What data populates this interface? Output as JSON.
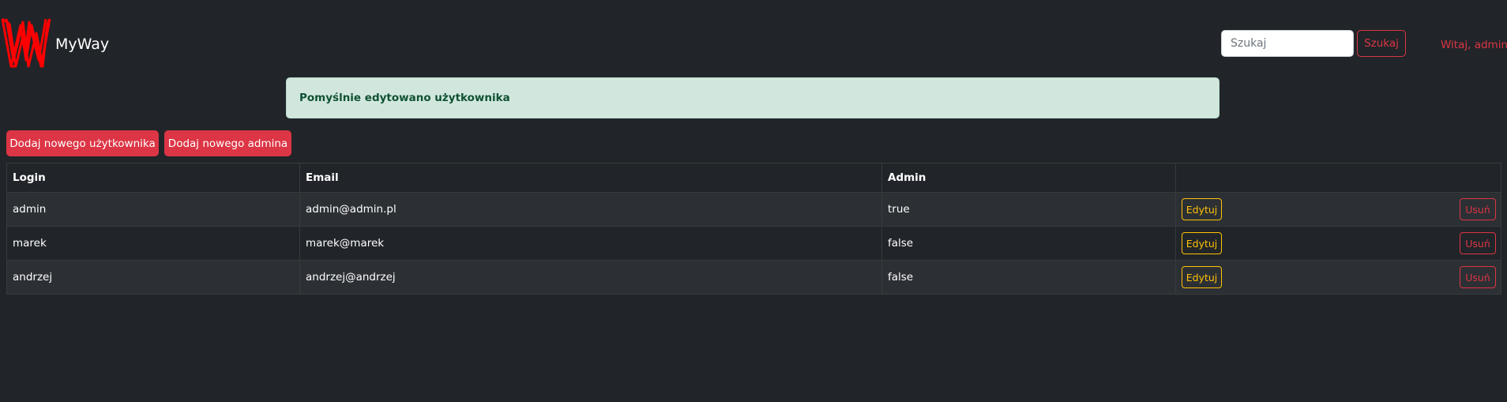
{
  "navbar": {
    "brand": "MyWay",
    "search_placeholder": "Szukaj",
    "search_button": "Szukaj",
    "user_menu": "Witaj, admin",
    "accent_color": "#dc3545"
  },
  "alert": {
    "message": "Pomyślnie edytowano użytkownika",
    "type": "success"
  },
  "actions": {
    "add_user": "Dodaj nowego użytkownika",
    "add_admin": "Dodaj nowego admina"
  },
  "table": {
    "headers": [
      "Login",
      "Email",
      "Admin",
      ""
    ],
    "edit_label": "Edytuj",
    "delete_label": "Usuń",
    "rows": [
      {
        "login": "admin",
        "email": "admin@admin.pl",
        "admin": "true"
      },
      {
        "login": "marek",
        "email": "marek@marek",
        "admin": "false"
      },
      {
        "login": "andrzej",
        "email": "andrzej@andrzej",
        "admin": "false"
      }
    ]
  }
}
